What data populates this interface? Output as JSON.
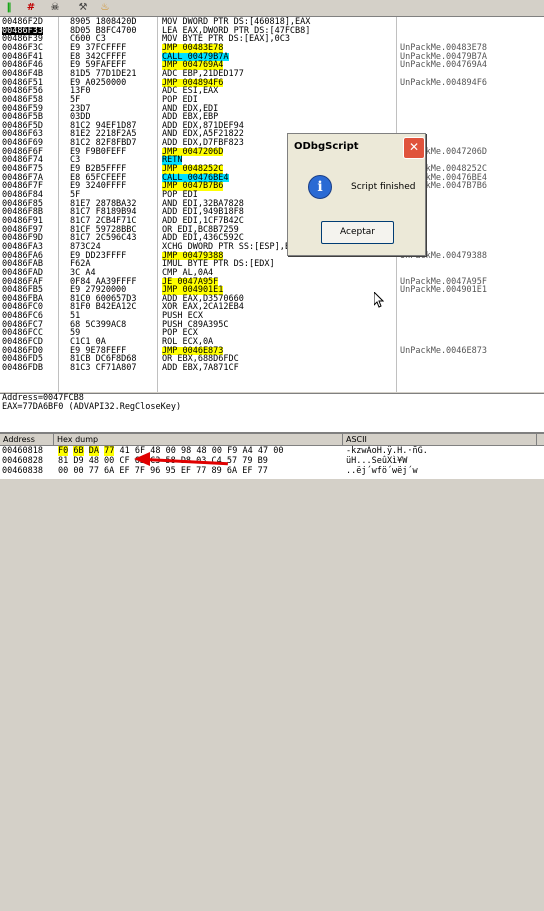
{
  "toolbar": {
    "icons": [
      "pause-icon",
      "script-icon",
      "skull-icon",
      "run-icon",
      "fire-icon"
    ]
  },
  "disasm": [
    {
      "addr": "00486F2D",
      "hex": "8905 1808420D",
      "dis": "MOV DWORD PTR DS:[460818],EAX",
      "com": "",
      "hl": ""
    },
    {
      "addr": "00486F33",
      "hex": "8D05 B8FC4700",
      "dis": "LEA EAX,DWORD PTR DS:[47FCB8]",
      "com": "",
      "hl": "",
      "sel": true
    },
    {
      "addr": "00486F39",
      "hex": "C600 C3",
      "dis": "MOV BYTE PTR DS:[EAX],0C3",
      "com": "",
      "hl": ""
    },
    {
      "addr": "00486F3C",
      "hex": "E9 37FCFFFF",
      "dis": "JMP 00483E78",
      "com": "UnPackMe.00483E78",
      "hl": "y"
    },
    {
      "addr": "00486F41",
      "hex": "E8 342CFFFF",
      "dis": "CALL 00479B7A",
      "com": "UnPackMe.00479B7A",
      "hl": "c"
    },
    {
      "addr": "00486F46",
      "hex": "E9 59FAFEFF",
      "dis": "JMP 004769A4",
      "com": "UnPackMe.004769A4",
      "hl": "y"
    },
    {
      "addr": "00486F4B",
      "hex": "81D5 77D1DE21",
      "dis": "ADC EBP,21DED177",
      "com": "",
      "hl": ""
    },
    {
      "addr": "00486F51",
      "hex": "E9 A0250000",
      "dis": "JMP 004894F6",
      "com": "UnPackMe.004894F6",
      "hl": "y"
    },
    {
      "addr": "00486F56",
      "hex": "13F0",
      "dis": "ADC ESI,EAX",
      "com": "",
      "hl": ""
    },
    {
      "addr": "00486F58",
      "hex": "5F",
      "dis": "POP EDI",
      "com": "",
      "hl": ""
    },
    {
      "addr": "00486F59",
      "hex": "23D7",
      "dis": "AND EDX,EDI",
      "com": "",
      "hl": ""
    },
    {
      "addr": "00486F5B",
      "hex": "03DD",
      "dis": "ADD EBX,EBP",
      "com": "",
      "hl": ""
    },
    {
      "addr": "00486F5D",
      "hex": "81C2 94EF1D87",
      "dis": "ADD EDX,871DEF94",
      "com": "",
      "hl": ""
    },
    {
      "addr": "00486F63",
      "hex": "81E2 2218F2A5",
      "dis": "AND EDX,A5F21822",
      "com": "",
      "hl": ""
    },
    {
      "addr": "00486F69",
      "hex": "81C2 82F8FBD7",
      "dis": "ADD EDX,D7FBF823",
      "com": "",
      "hl": ""
    },
    {
      "addr": "00486F6F",
      "hex": "E9 F9B0FEFF",
      "dis": "JMP 0047206D",
      "com": "UnPackMe.0047206D",
      "hl": "y"
    },
    {
      "addr": "00486F74",
      "hex": "C3",
      "dis": "RETN",
      "com": "",
      "hl": "c"
    },
    {
      "addr": "00486F75",
      "hex": "E9 B2B5FFFF",
      "dis": "JMP 0048252C",
      "com": "UnPackMe.0048252C",
      "hl": "y"
    },
    {
      "addr": "00486F7A",
      "hex": "E8 65FCFEFF",
      "dis": "CALL 00476BE4",
      "com": "UnPackMe.00476BE4",
      "hl": "c"
    },
    {
      "addr": "00486F7F",
      "hex": "E9 3240FFFF",
      "dis": "JMP 0047B7B6",
      "com": "UnPackMe.0047B7B6",
      "hl": "y"
    },
    {
      "addr": "00486F84",
      "hex": "5F",
      "dis": "POP EDI",
      "com": "",
      "hl": ""
    },
    {
      "addr": "00486F85",
      "hex": "81E7 2878BA32",
      "dis": "AND EDI,32BA7828",
      "com": "",
      "hl": ""
    },
    {
      "addr": "00486F8B",
      "hex": "81C7 F8189B94",
      "dis": "ADD EDI,949B18F8",
      "com": "",
      "hl": ""
    },
    {
      "addr": "00486F91",
      "hex": "81C7 2CB4F71C",
      "dis": "ADD EDI,1CF7B42C",
      "com": "",
      "hl": ""
    },
    {
      "addr": "00486F97",
      "hex": "81CF 59728BBC",
      "dis": "OR EDI,BC8B7259",
      "com": "",
      "hl": ""
    },
    {
      "addr": "00486F9D",
      "hex": "81C7 2C596C43",
      "dis": "ADD EDI,436C592C",
      "com": "",
      "hl": ""
    },
    {
      "addr": "00486FA3",
      "hex": "873C24",
      "dis": "XCHG DWORD PTR SS:[ESP],EDI",
      "com": "",
      "hl": ""
    },
    {
      "addr": "00486FA6",
      "hex": "E9 DD23FFFF",
      "dis": "JMP 00479388",
      "com": "UnPackMe.00479388",
      "hl": "y"
    },
    {
      "addr": "00486FAB",
      "hex": "F62A",
      "dis": "IMUL BYTE PTR DS:[EDX]",
      "com": "",
      "hl": ""
    },
    {
      "addr": "00486FAD",
      "hex": "3C A4",
      "dis": "CMP AL,0A4",
      "com": "",
      "hl": ""
    },
    {
      "addr": "00486FAF",
      "hex": "0F84 AA39FFFF",
      "dis": "JE 0047A95F",
      "com": "UnPackMe.0047A95F",
      "hl": "y"
    },
    {
      "addr": "00486FB5",
      "hex": "E9 27920000",
      "dis": "JMP 004901E1",
      "com": "UnPackMe.004901E1",
      "hl": "y"
    },
    {
      "addr": "00486FBA",
      "hex": "81C0 600657D3",
      "dis": "ADD EAX,D3570660",
      "com": "",
      "hl": ""
    },
    {
      "addr": "00486FC0",
      "hex": "81F0 B42EA12C",
      "dis": "XOR EAX,2CA12EB4",
      "com": "",
      "hl": ""
    },
    {
      "addr": "00486FC6",
      "hex": "51",
      "dis": "PUSH ECX",
      "com": "",
      "hl": ""
    },
    {
      "addr": "00486FC7",
      "hex": "68 5C399AC8",
      "dis": "PUSH C89A395C",
      "com": "",
      "hl": ""
    },
    {
      "addr": "00486FCC",
      "hex": "59",
      "dis": "POP ECX",
      "com": "",
      "hl": ""
    },
    {
      "addr": "00486FCD",
      "hex": "C1C1 0A",
      "dis": "ROL ECX,0A",
      "com": "",
      "hl": ""
    },
    {
      "addr": "00486FD0",
      "hex": "E9 9E78FEFF",
      "dis": "JMP 0046E873",
      "com": "UnPackMe.0046E873",
      "hl": "y"
    },
    {
      "addr": "00486FD5",
      "hex": "81CB DC6F8D68",
      "dis": "OR EBX,688D6FDC",
      "com": "",
      "hl": ""
    },
    {
      "addr": "00486FDB",
      "hex": "81C3 CF71A807",
      "dis": "ADD EBX,7A871CF",
      "com": "",
      "hl": ""
    }
  ],
  "info": {
    "line1": "Address=0047FCB8",
    "line2": "EAX=77DA6BF0 (ADVAPI32.RegCloseKey)"
  },
  "dump": {
    "headers": {
      "address": "Address",
      "hex": "Hex dump",
      "ascii": "ASCII"
    },
    "rows": [
      {
        "addr": "00460818",
        "hex": "F0 6B DA 77 41 6F 48 00 98 48 00 F9 A4 47 00",
        "asc": "-kzwAoH.ÿ.H.·ñG."
      },
      {
        "addr": "00460828",
        "hex": "81 D9 48 00 CF 65 C3 58 D8 03 C4 57 79 B9",
        "asc": "üH...SeûXì¥W"
      },
      {
        "addr": "00460838",
        "hon": "",
        "hex": "00 00 77 6A EF 7F 96 95 EF 77 89 6A EF 77",
        "asc": "..ëj´wfö´wëj´w"
      }
    ]
  },
  "dialog": {
    "title": "ODbgScript",
    "close": "✕",
    "message": "Script finished",
    "button": "Aceptar",
    "icon": "i"
  }
}
